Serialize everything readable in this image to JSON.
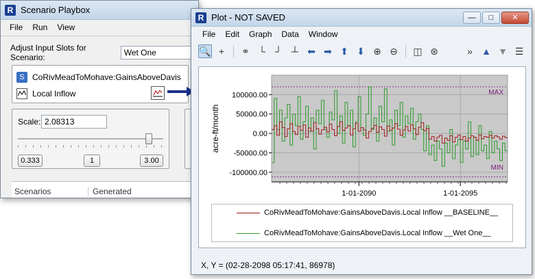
{
  "playbox": {
    "title": "Scenario Playbox",
    "menu": [
      "File",
      "Run",
      "View"
    ],
    "adjust_label": "Adjust Input Slots for Scenario:",
    "scenario_value": "Wet One",
    "slot_name": "CoRivMeadToMohave:GainsAboveDavis",
    "slot_item": "Local Inflow",
    "scale_label": "Scale:",
    "scale_value": "2.08313",
    "slider_fraction": 0.9,
    "btn_min": "0.333",
    "btn_one": "1",
    "btn_max": "3.00",
    "col_scenarios": "Scenarios",
    "col_generated": "Generated"
  },
  "plotwin": {
    "title": "Plot - NOT SAVED",
    "menu": [
      "File",
      "Edit",
      "Graph",
      "Data",
      "Window"
    ],
    "status": "X, Y = (02-28-2098 05:17:41, 86978)"
  },
  "chart_data": {
    "type": "line",
    "ylabel": "acre-ft/month",
    "ylim": [
      -125000,
      150000
    ],
    "yticks": [
      "100000.00",
      "50000.00",
      "0.00",
      "-50000.00",
      "-100000.00"
    ],
    "ytick_values": [
      100000,
      50000,
      0,
      -50000,
      -100000
    ],
    "xticks": [
      "1-01-2090",
      "1-01-2095"
    ],
    "xtick_positions": [
      0.37,
      0.8
    ],
    "max_line": 120000,
    "min_line": -112000,
    "max_label": "MAX",
    "min_label": "MIN",
    "series": [
      {
        "name": "CoRivMeadToMohave:GainsAboveDavis.Local Inflow __BASELINE__",
        "color": "#a01818",
        "values": [
          10000,
          20000,
          -5000,
          30000,
          15000,
          -8000,
          12000,
          25000,
          5000,
          -3000,
          18000,
          8000,
          22000,
          -10000,
          14000,
          6000,
          28000,
          12000,
          -2000,
          9000,
          16000,
          4000,
          24000,
          10000,
          -6000,
          18000,
          30000,
          8000,
          14000,
          20000,
          -4000,
          12000,
          26000,
          6000,
          15000,
          9000,
          -12000,
          5000,
          13000,
          21000,
          3000,
          17000,
          10000,
          -7000,
          19000,
          8000,
          14000,
          25000,
          11000,
          -5000,
          9000,
          18000,
          6000,
          22000,
          12000,
          -3000,
          16000,
          28000,
          7000,
          13000,
          -15000,
          -8000,
          -20000,
          -10000,
          -5000,
          -25000,
          -12000,
          -18000,
          -6000,
          -22000,
          -10000,
          -4000,
          -16000,
          -8000,
          -20000,
          -12000,
          -6000,
          -10000,
          -18000,
          -4000,
          -14000,
          -8000,
          -10000,
          -5000,
          -12000,
          -6000,
          -9000,
          -15000,
          -7000,
          -11000
        ]
      },
      {
        "name": "CoRivMeadToMohave:GainsAboveDavis.Local Inflow __Wet One__",
        "color": "#2a9a2a",
        "values": [
          -75000,
          90000,
          10000,
          60000,
          -20000,
          40000,
          75000,
          -30000,
          50000,
          20000,
          95000,
          -15000,
          30000,
          70000,
          5000,
          40000,
          -40000,
          60000,
          25000,
          85000,
          10000,
          -10000,
          55000,
          35000,
          110000,
          0,
          45000,
          -25000,
          80000,
          20000,
          60000,
          -35000,
          30000,
          95000,
          15000,
          -5000,
          50000,
          120000,
          10000,
          40000,
          -20000,
          70000,
          30000,
          115000,
          5000,
          35000,
          -30000,
          60000,
          20000,
          80000,
          -10000,
          45000,
          25000,
          65000,
          -15000,
          30000,
          50000,
          10000,
          -45000,
          20000,
          -55000,
          -30000,
          -70000,
          -20000,
          -40000,
          -85000,
          -25000,
          -50000,
          10000,
          -65000,
          -30000,
          -15000,
          -75000,
          -20000,
          -40000,
          30000,
          -60000,
          -10000,
          -55000,
          20000,
          -45000,
          -30000,
          -65000,
          5000,
          -50000,
          -20000,
          -40000,
          -70000,
          -25000,
          -45000
        ]
      }
    ]
  }
}
